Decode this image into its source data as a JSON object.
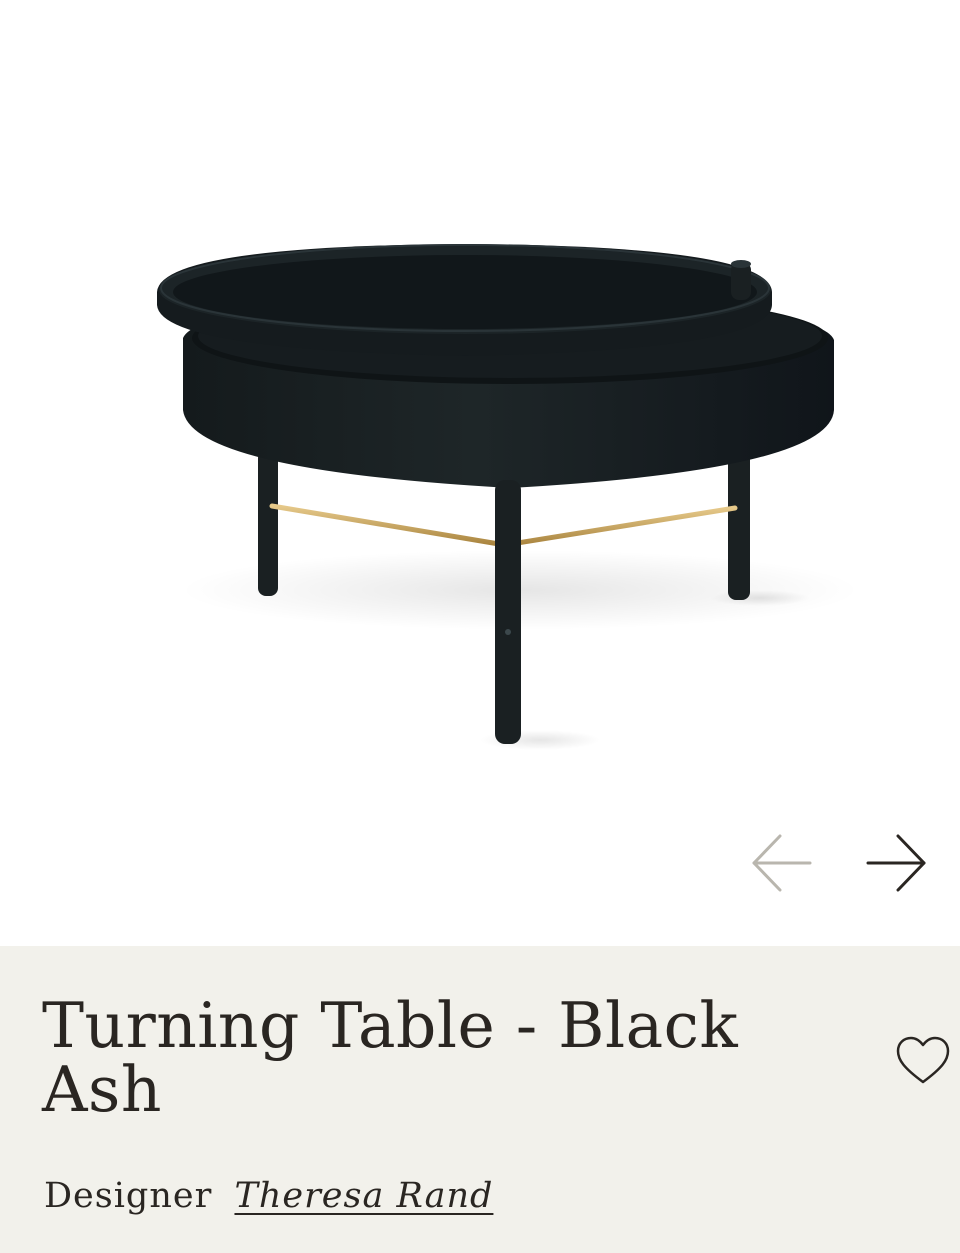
{
  "gallery": {
    "image_subject": "round black ash table with rotating tray top, three legs and brass crossbar",
    "prev_icon": "arrow-left-icon",
    "next_icon": "arrow-right-icon"
  },
  "product": {
    "title": "Turning Table - Black Ash",
    "designer_label": "Designer",
    "designer_name": "Theresa Rand",
    "wishlist_icon": "heart-outline-icon"
  },
  "colors": {
    "info_background": "#f2f1eb",
    "text": "#2a2622",
    "table_black": "#1a2022",
    "brass": "#c9a55a",
    "arrow_disabled": "#b9b6ae"
  }
}
